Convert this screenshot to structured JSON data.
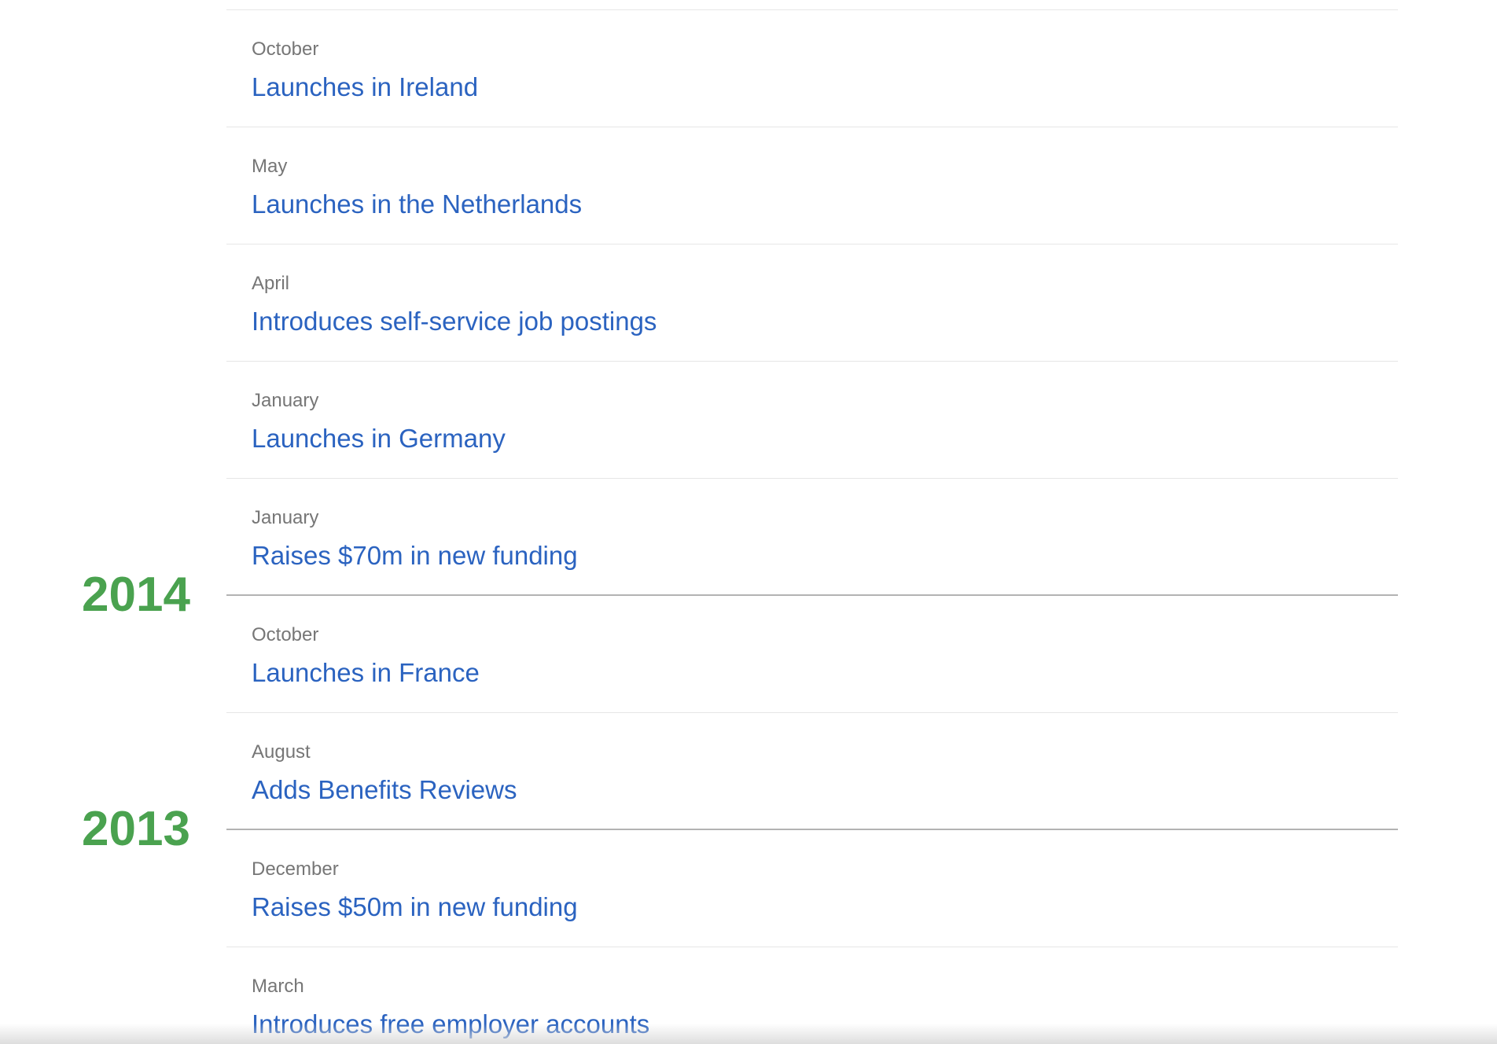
{
  "timeline": {
    "years": [
      {
        "label": "2014"
      },
      {
        "label": "2013"
      }
    ],
    "entries": [
      {
        "month": "October",
        "title": "Launches in Ireland"
      },
      {
        "month": "May",
        "title": "Launches in the Netherlands"
      },
      {
        "month": "April",
        "title": "Introduces self-service job postings"
      },
      {
        "month": "January",
        "title": "Launches in Germany"
      },
      {
        "month": "January",
        "title": "Raises $70m in new funding"
      },
      {
        "month": "October",
        "title": "Launches in France"
      },
      {
        "month": "August",
        "title": "Adds Benefits Reviews"
      },
      {
        "month": "December",
        "title": "Raises $50m in new funding"
      },
      {
        "month": "March",
        "title": "Introduces free employer accounts"
      }
    ]
  },
  "colors": {
    "link": "#2b63c0",
    "month": "#767676",
    "year": "#4aa24f",
    "divider": "#e6e6e6",
    "year_divider": "#b3b3b3"
  }
}
